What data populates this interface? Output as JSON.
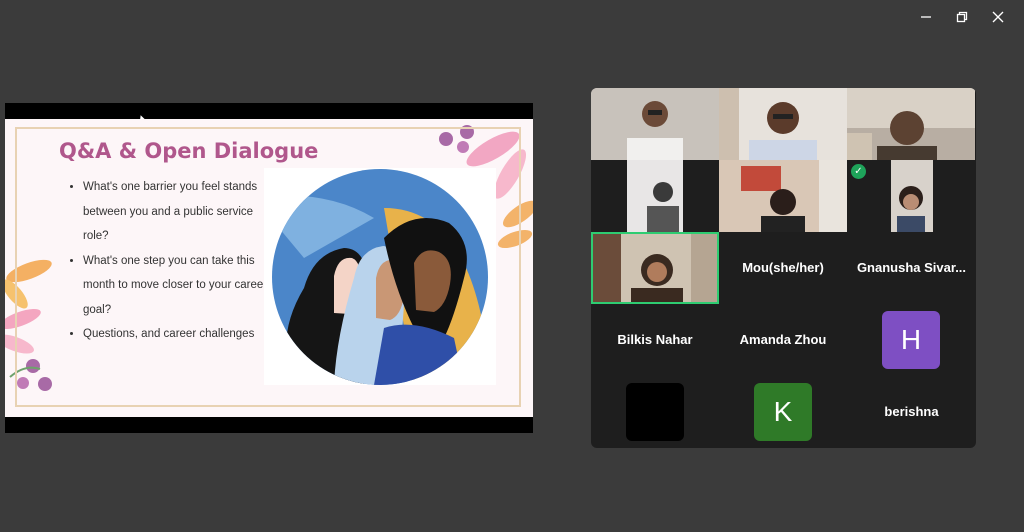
{
  "window": {
    "controls": [
      {
        "name": "minimize",
        "icon": "minimize-icon"
      },
      {
        "name": "restore",
        "icon": "restore-icon"
      },
      {
        "name": "close",
        "icon": "close-icon"
      }
    ]
  },
  "slide": {
    "title": "Q&A & Open Dialogue",
    "bullets": [
      "What's one barrier you feel stands between you and a public service role?",
      "What's one step you can take this month to move closer to your career goal?",
      "Questions, and career challenges"
    ]
  },
  "gallery": {
    "participants": [
      {
        "name": "",
        "type": "video"
      },
      {
        "name": "",
        "type": "video"
      },
      {
        "name": "",
        "type": "video"
      },
      {
        "name": "",
        "type": "video"
      },
      {
        "name": "",
        "type": "video"
      },
      {
        "name": "",
        "type": "video",
        "verified": true
      },
      {
        "name": "",
        "type": "video",
        "active": true
      },
      {
        "name": "Mou(she/her)",
        "type": "name"
      },
      {
        "name": "Gnanusha  Sivar...",
        "type": "name"
      },
      {
        "name": "Bilkis Nahar",
        "type": "name"
      },
      {
        "name": "Amanda Zhou",
        "type": "name"
      },
      {
        "name": "",
        "type": "avatar",
        "initial": "H",
        "color": "#7e4fc3"
      },
      {
        "name": "",
        "type": "avatar",
        "initial": "",
        "color": "#000000"
      },
      {
        "name": "",
        "type": "avatar",
        "initial": "K",
        "color": "#2f7a28"
      },
      {
        "name": "berishna",
        "type": "name"
      }
    ]
  }
}
